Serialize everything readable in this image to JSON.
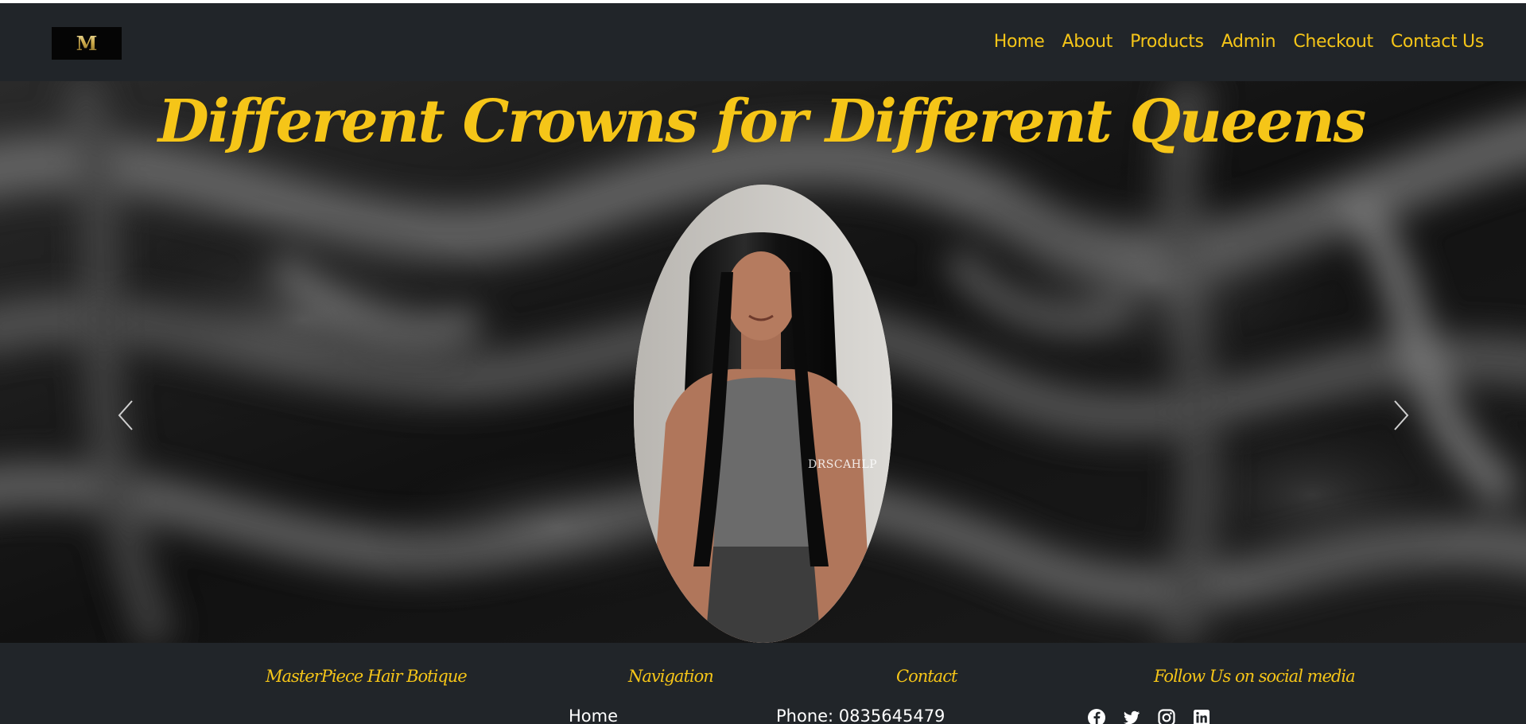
{
  "navbar": {
    "logo_text": "M",
    "links": [
      "Home",
      "About",
      "Products",
      "Admin",
      "Checkout",
      "Contact Us"
    ]
  },
  "hero": {
    "title": "Different Crowns for Different Queens",
    "watermark": "DRSCAHLP",
    "prev_icon": "chevron-left-icon",
    "next_icon": "chevron-right-icon"
  },
  "footer": {
    "brand_heading": "MasterPiece Hair Botique",
    "nav_heading": "Navigation",
    "nav_first": "Home",
    "contact_heading": "Contact",
    "phone": "Phone: 0835645479",
    "social_heading": "Follow Us on social media",
    "social_icons": [
      "facebook-icon",
      "twitter-icon",
      "instagram-icon",
      "linkedin-icon"
    ]
  },
  "colors": {
    "navbar_bg": "#212529",
    "accent_gold": "#f5c518",
    "hero_bg": "#0b0b0b"
  }
}
